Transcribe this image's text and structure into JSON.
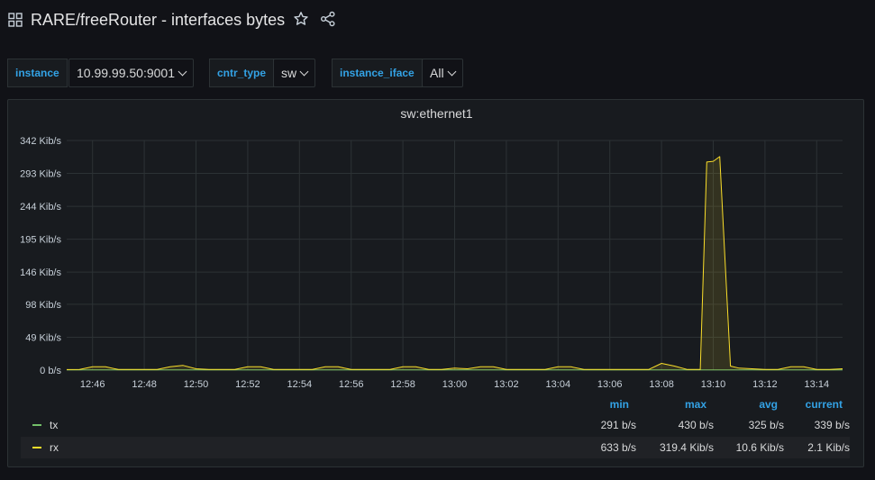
{
  "dashboard": {
    "title": "RARE/freeRouter - interfaces bytes"
  },
  "variables": [
    {
      "label": "instance",
      "value": "10.99.99.50:9001"
    },
    {
      "label": "cntr_type",
      "value": "sw"
    },
    {
      "label": "instance_iface",
      "value": "All"
    }
  ],
  "panel": {
    "title": "sw:ethernet1"
  },
  "colors": {
    "tx": "#73bf69",
    "rx": "#fade2a",
    "accent": "#33a2e5"
  },
  "legend": {
    "headers": {
      "min": "min",
      "max": "max",
      "avg": "avg",
      "current": "current"
    },
    "rows": [
      {
        "name": "tx",
        "min": "291 b/s",
        "max": "430 b/s",
        "avg": "325 b/s",
        "current": "339 b/s"
      },
      {
        "name": "rx",
        "min": "633 b/s",
        "max": "319.4 Kib/s",
        "avg": "10.6 Kib/s",
        "current": "2.1 Kib/s"
      }
    ]
  },
  "chart_data": {
    "type": "line",
    "title": "sw:ethernet1",
    "xlabel": "",
    "ylabel": "",
    "y_unit": "Kib/s",
    "ylim": [
      0,
      342
    ],
    "y_tick_labels": [
      "0 b/s",
      "49 Kib/s",
      "98 Kib/s",
      "146 Kib/s",
      "195 Kib/s",
      "244 Kib/s",
      "293 Kib/s",
      "342 Kib/s"
    ],
    "y_tick_values": [
      0,
      49,
      98,
      146,
      195,
      244,
      293,
      342
    ],
    "x_range": [
      "12:45",
      "13:15"
    ],
    "x_tick_labels": [
      "12:46",
      "12:48",
      "12:50",
      "12:52",
      "12:54",
      "12:56",
      "12:58",
      "13:00",
      "13:02",
      "13:04",
      "13:06",
      "13:08",
      "13:10",
      "13:12",
      "13:14"
    ],
    "grid": true,
    "legend_position": "bottom",
    "series": [
      {
        "name": "tx",
        "color": "#73bf69",
        "points": [
          [
            "12:45",
            0.3
          ],
          [
            "12:46",
            0.3
          ],
          [
            "12:48",
            0.4
          ],
          [
            "12:50",
            0.3
          ],
          [
            "12:52",
            0.3
          ],
          [
            "12:54",
            0.3
          ],
          [
            "12:56",
            0.3
          ],
          [
            "12:58",
            0.4
          ],
          [
            "13:00",
            0.3
          ],
          [
            "13:02",
            0.3
          ],
          [
            "13:04",
            0.3
          ],
          [
            "13:06",
            0.3
          ],
          [
            "13:08",
            0.4
          ],
          [
            "13:10",
            0.3
          ],
          [
            "13:12",
            0.3
          ],
          [
            "13:14",
            0.3
          ],
          [
            "13:15",
            0.3
          ]
        ]
      },
      {
        "name": "rx",
        "color": "#fade2a",
        "points": [
          [
            "12:45",
            0.8
          ],
          [
            "12:45:30",
            1
          ],
          [
            "12:46",
            5
          ],
          [
            "12:46:30",
            5
          ],
          [
            "12:47",
            1
          ],
          [
            "12:47:30",
            1
          ],
          [
            "12:48",
            1
          ],
          [
            "12:48:30",
            1
          ],
          [
            "12:49",
            5
          ],
          [
            "12:49:30",
            7
          ],
          [
            "12:50",
            2
          ],
          [
            "12:50:30",
            1
          ],
          [
            "12:51",
            1
          ],
          [
            "12:51:30",
            1
          ],
          [
            "12:52",
            5
          ],
          [
            "12:52:30",
            5
          ],
          [
            "12:53",
            1
          ],
          [
            "12:53:30",
            1
          ],
          [
            "12:54",
            1
          ],
          [
            "12:54:30",
            1
          ],
          [
            "12:55",
            5
          ],
          [
            "12:55:30",
            5
          ],
          [
            "12:56",
            1
          ],
          [
            "12:56:30",
            1
          ],
          [
            "12:57",
            1
          ],
          [
            "12:57:30",
            1
          ],
          [
            "12:58",
            5
          ],
          [
            "12:58:30",
            5
          ],
          [
            "12:59",
            1
          ],
          [
            "12:59:30",
            1
          ],
          [
            "13:00",
            3
          ],
          [
            "13:00:30",
            2
          ],
          [
            "13:01",
            5
          ],
          [
            "13:01:30",
            5
          ],
          [
            "13:02",
            1
          ],
          [
            "13:02:30",
            1
          ],
          [
            "13:03",
            1
          ],
          [
            "13:03:30",
            1
          ],
          [
            "13:04",
            5
          ],
          [
            "13:04:30",
            5
          ],
          [
            "13:05",
            1
          ],
          [
            "13:05:30",
            1
          ],
          [
            "13:06",
            1
          ],
          [
            "13:06:30",
            1
          ],
          [
            "13:07",
            1
          ],
          [
            "13:07:30",
            1
          ],
          [
            "13:08",
            10
          ],
          [
            "13:08:30",
            6
          ],
          [
            "13:09",
            1
          ],
          [
            "13:09:30",
            1
          ],
          [
            "13:09:45",
            310
          ],
          [
            "13:10",
            311
          ],
          [
            "13:10:15",
            318
          ],
          [
            "13:10:40",
            6
          ],
          [
            "13:11",
            3
          ],
          [
            "13:11:30",
            2
          ],
          [
            "13:12",
            1
          ],
          [
            "13:12:30",
            1
          ],
          [
            "13:13",
            5
          ],
          [
            "13:13:30",
            5
          ],
          [
            "13:14",
            1
          ],
          [
            "13:14:30",
            1
          ],
          [
            "13:15",
            2
          ]
        ]
      }
    ]
  }
}
